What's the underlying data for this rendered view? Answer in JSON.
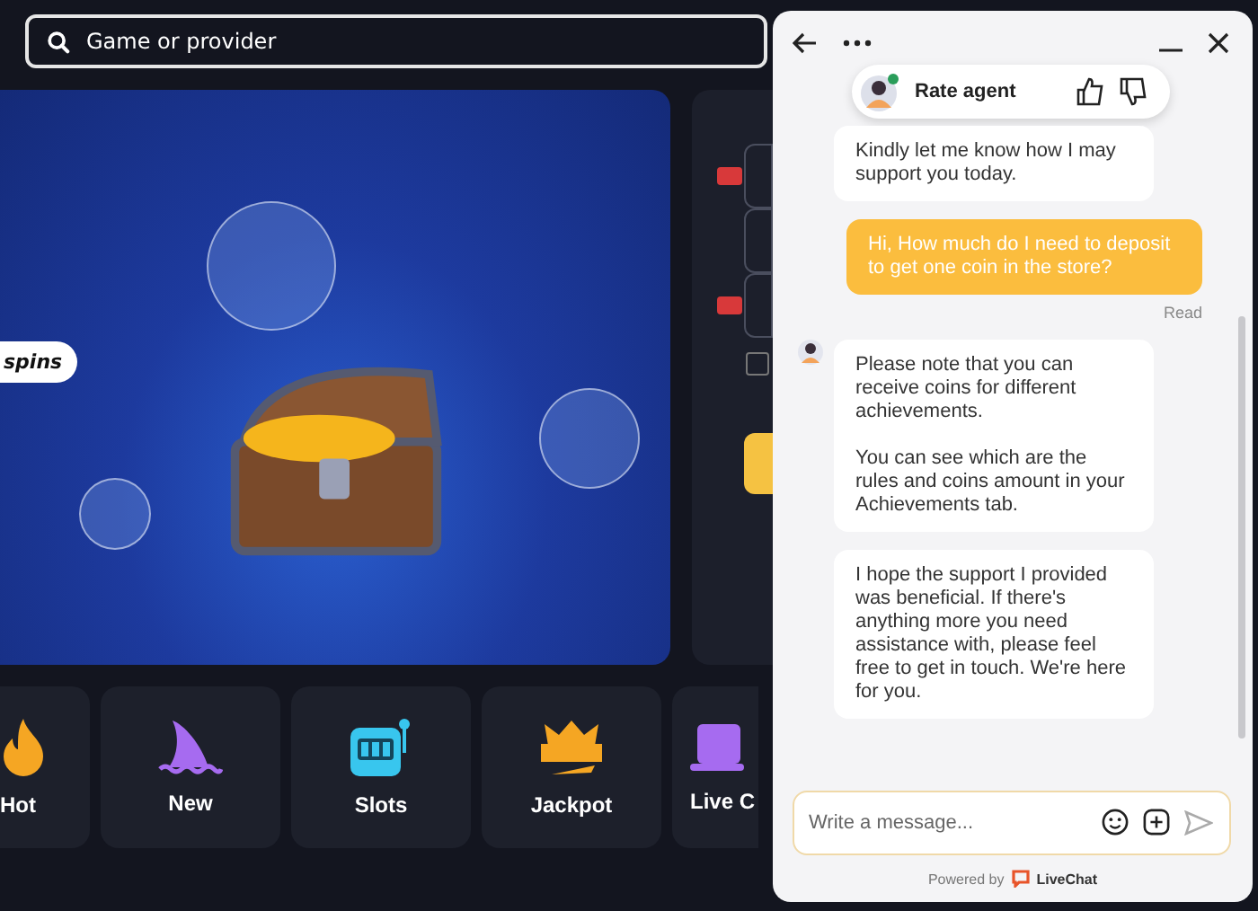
{
  "search": {
    "placeholder": "Game or provider"
  },
  "banner": {
    "badge": "spins"
  },
  "form": {
    "fields": [
      {
        "kind": "field"
      },
      {
        "kind": "field"
      },
      {
        "kind": "field"
      }
    ],
    "remember": {
      "checked": false
    }
  },
  "categories": [
    {
      "label": "Hot",
      "kind": "hot"
    },
    {
      "label": "New",
      "kind": "new"
    },
    {
      "label": "Slots",
      "kind": "slots"
    },
    {
      "label": "Jackpot",
      "kind": "jackpot"
    },
    {
      "label": "Live C",
      "kind": "live"
    }
  ],
  "chat": {
    "rate_label": "Rate agent",
    "messages": [
      {
        "kind": "agent",
        "avatar": false,
        "paragraphs": [
          "Kindly let me know how I may support you today."
        ]
      },
      {
        "kind": "user",
        "paragraphs": [
          "Hi, How much do I need to deposit to get one coin in the store?"
        ],
        "status": "Read"
      },
      {
        "kind": "agent",
        "avatar": true,
        "paragraphs": [
          "Please note that you can receive coins for different achievements.",
          "You can see which are the rules and coins amount in your Achievements tab."
        ]
      },
      {
        "kind": "agent",
        "avatar": false,
        "paragraphs": [
          "I hope the support I provided was beneficial. If there's anything more you need assistance with, please feel free to get in touch. We're here for you."
        ]
      }
    ],
    "composer": {
      "placeholder": "Write a message..."
    },
    "powered_by": "Powered by",
    "brand": "LiveChat"
  }
}
